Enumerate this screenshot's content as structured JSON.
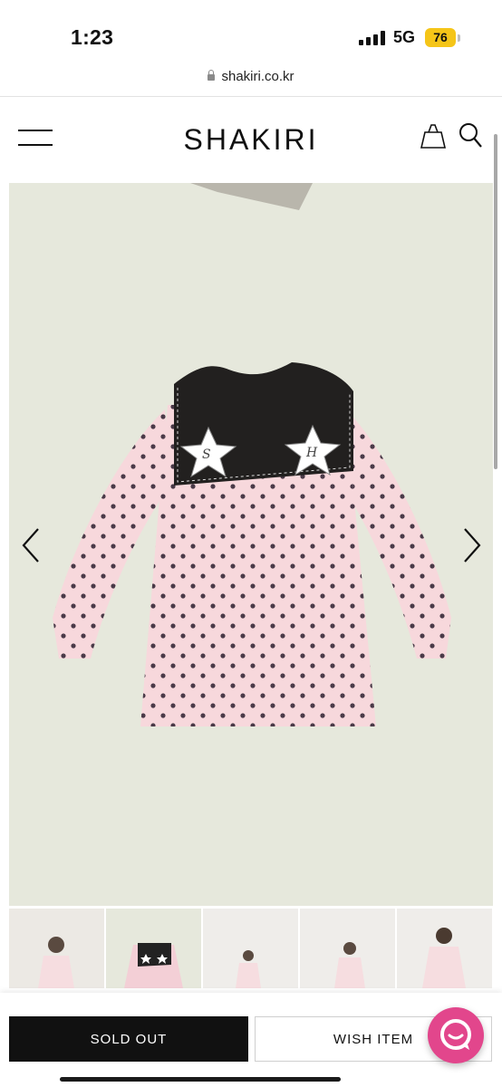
{
  "status_bar": {
    "time": "1:23",
    "network": "5G",
    "battery": "76"
  },
  "browser": {
    "url": "shakiri.co.kr"
  },
  "header": {
    "logo_text": "SHAKIRI"
  },
  "product_gallery": {
    "main_image": "pink polka-dot sailor-collar dress with star patches",
    "thumbnail_count": 5
  },
  "actions": {
    "sold_out_label": "SOLD OUT",
    "wish_label": "WISH ITEM"
  },
  "colors": {
    "accent_chat": "#e2468c",
    "battery": "#f5c518",
    "button_dark": "#111111"
  }
}
